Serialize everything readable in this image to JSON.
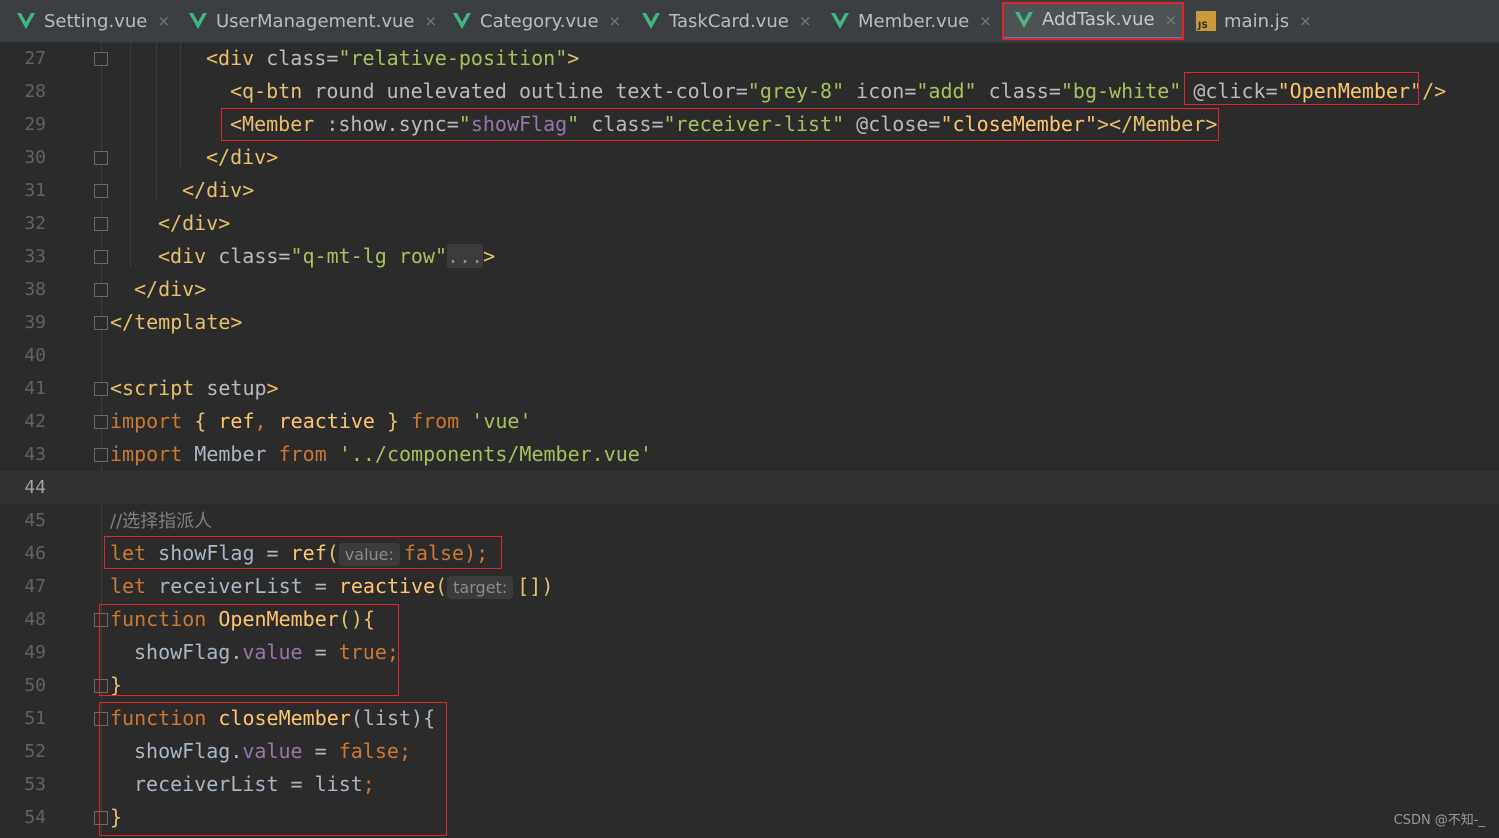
{
  "tabs": [
    {
      "label": "Setting.vue",
      "type": "vue"
    },
    {
      "label": "UserManagement.vue",
      "type": "vue"
    },
    {
      "label": "Category.vue",
      "type": "vue"
    },
    {
      "label": "TaskCard.vue",
      "type": "vue"
    },
    {
      "label": "Member.vue",
      "type": "vue"
    },
    {
      "label": "AddTask.vue",
      "type": "vue",
      "active": true
    },
    {
      "label": "main.js",
      "type": "js"
    }
  ],
  "js_icon_text": "JS",
  "close_glyph": "×",
  "colors": {
    "highlight_box": "#e0262b",
    "editor_bg": "#2b2b2b",
    "tab_bg": "#3c3f41"
  },
  "lines": {
    "27": {
      "num": "27"
    },
    "28": {
      "num": "28"
    },
    "29": {
      "num": "29"
    },
    "30": {
      "num": "30"
    },
    "31": {
      "num": "31"
    },
    "32": {
      "num": "32"
    },
    "33": {
      "num": "33"
    },
    "38": {
      "num": "38"
    },
    "39": {
      "num": "39"
    },
    "40": {
      "num": "40"
    },
    "41": {
      "num": "41"
    },
    "42": {
      "num": "42"
    },
    "43": {
      "num": "43"
    },
    "44": {
      "num": "44"
    },
    "45": {
      "num": "45"
    },
    "46": {
      "num": "46"
    },
    "47": {
      "num": "47"
    },
    "48": {
      "num": "48"
    },
    "49": {
      "num": "49"
    },
    "50": {
      "num": "50"
    },
    "51": {
      "num": "51"
    },
    "52": {
      "num": "52"
    },
    "53": {
      "num": "53"
    },
    "54": {
      "num": "54"
    }
  },
  "code": {
    "l27": [
      "<div ",
      "class=",
      "\"relative-position\"",
      ">"
    ],
    "l28": [
      "<q-btn ",
      "round unelevated outline ",
      "text-color=",
      "\"grey-8\"",
      " icon=",
      "\"add\"",
      " class=",
      "\"bg-white\"",
      " @click=",
      "\"OpenMember\"",
      "/>"
    ],
    "l29": [
      "<Member ",
      ":show.sync=",
      "\"",
      "showFlag",
      "\"",
      " class=",
      "\"receiver-list\"",
      " @close=",
      "\"closeMember\"",
      "></Member>"
    ],
    "l30": [
      "</div>"
    ],
    "l31": [
      "</div>"
    ],
    "l32": [
      "</div>"
    ],
    "l33": [
      "<div ",
      "class=",
      "\"q-mt-lg row\"",
      "...",
      ">"
    ],
    "l38": [
      "</div>"
    ],
    "l39": [
      "</template>"
    ],
    "l41": [
      "<script ",
      "setup",
      ">"
    ],
    "l42": [
      "import ",
      "{ ",
      "ref",
      ", ",
      "reactive",
      " } ",
      "from ",
      "'vue'"
    ],
    "l43": [
      "import ",
      "Member ",
      "from ",
      "'../components/Member.vue'"
    ],
    "l45": [
      "//选择指派人"
    ],
    "l46": [
      "let ",
      "showFlag = ",
      "ref",
      "(",
      "value:",
      "false",
      ");"
    ],
    "l47": [
      "let ",
      "receiverList = ",
      "reactive",
      "(",
      "target:",
      "[]",
      ")"
    ],
    "l48": [
      "function ",
      "OpenMember",
      "(){"
    ],
    "l49": [
      "showFlag.",
      "value",
      " = ",
      "true",
      ";"
    ],
    "l50": [
      "}"
    ],
    "l51": [
      "function ",
      "closeMember",
      "(list){"
    ],
    "l52": [
      "showFlag.",
      "value",
      " = ",
      "false",
      ";"
    ],
    "l53": [
      "receiverList = list",
      ";"
    ],
    "l54": [
      "}"
    ]
  },
  "watermark": "CSDN @不知-_"
}
